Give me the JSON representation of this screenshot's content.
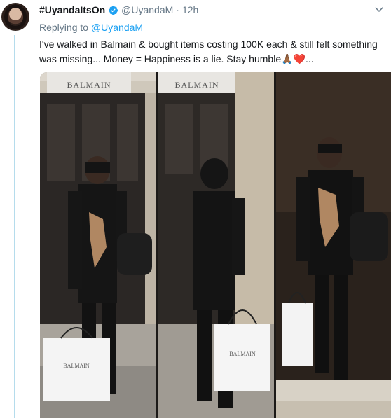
{
  "tweet": {
    "display_name": "#UyandaItsOn",
    "handle": "@UyandaM",
    "separator": "·",
    "time": "12h",
    "replying_prefix": "Replying to",
    "replying_to": "@UyandaM",
    "text_line1": "I've walked in Balmain & bought items costing 100K each & still felt something",
    "text_line2": "was missing... Money = Happiness is a lie. Stay humble",
    "text_emojis": "🙏🏾❤️",
    "text_ellipsis": "...",
    "verified_icon": "verified-badge-icon",
    "menu_icon": "chevron-down-icon",
    "accent_color": "#1da1f2",
    "thread_line_color": "#b5dcec"
  },
  "media": {
    "store_sign": "BALMAIN",
    "bag_brand": "BALMAIN",
    "photos": 3
  }
}
